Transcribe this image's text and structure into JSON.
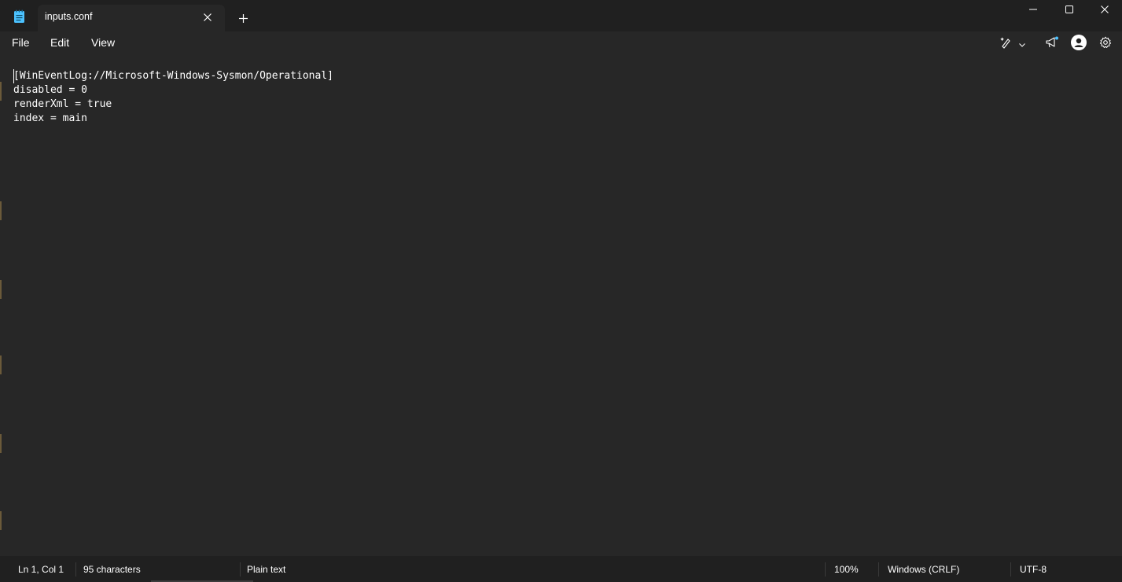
{
  "window": {
    "tab_title": "inputs.conf",
    "new_tab_label": "+"
  },
  "menu": {
    "file": "File",
    "edit": "Edit",
    "view": "View"
  },
  "document": {
    "lines": [
      "[WinEventLog://Microsoft-Windows-Sysmon/Operational]",
      "disabled = 0",
      "renderXml = true",
      "index = main"
    ]
  },
  "status": {
    "position": "Ln 1, Col 1",
    "characters": "95 characters",
    "file_type": "Plain text",
    "zoom": "100%",
    "line_ending": "Windows (CRLF)",
    "encoding": "UTF-8"
  },
  "icons": {
    "app": "notepad-icon",
    "tab_close": "close-icon",
    "copilot": "sparkle-pen-icon",
    "whats_new": "megaphone-icon",
    "account": "account-icon",
    "settings": "gear-icon"
  },
  "colors": {
    "titlebar_bg": "#202020",
    "editor_bg": "#272727",
    "text": "#ffffff",
    "accent": "#4cc2ff"
  }
}
